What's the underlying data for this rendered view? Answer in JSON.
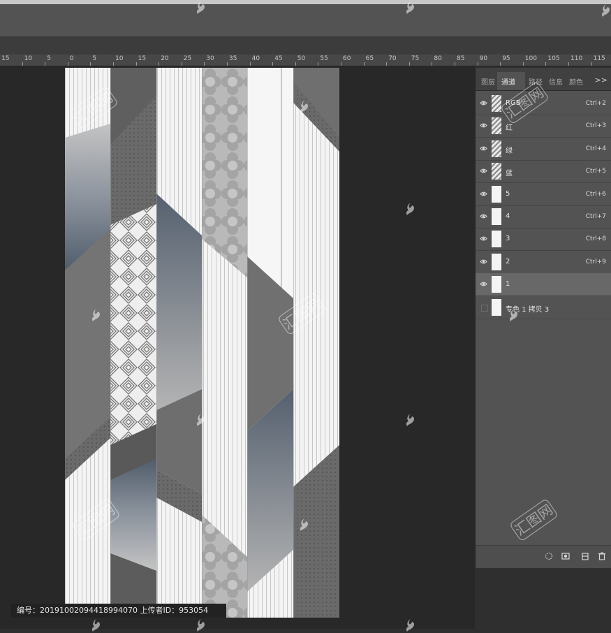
{
  "ruler": {
    "labels": [
      "15",
      "10",
      "5",
      "0",
      "5",
      "10",
      "15",
      "20",
      "25",
      "30",
      "35",
      "40",
      "45",
      "50",
      "55",
      "60",
      "65",
      "70",
      "75",
      "80",
      "85",
      "90",
      "95",
      "100",
      "105",
      "110",
      "115"
    ]
  },
  "panel": {
    "tabs": [
      "图层",
      "通道",
      "路径",
      "信息",
      "颜色"
    ],
    "menu": ">>",
    "channels": [
      {
        "name": "RGB",
        "shortcut": "Ctrl+2",
        "visible": true,
        "thumb": "pattern",
        "selected": false
      },
      {
        "name": "红",
        "shortcut": "Ctrl+3",
        "visible": true,
        "thumb": "pattern",
        "selected": false
      },
      {
        "name": "绿",
        "shortcut": "Ctrl+4",
        "visible": true,
        "thumb": "pattern",
        "selected": false
      },
      {
        "name": "蓝",
        "shortcut": "Ctrl+5",
        "visible": true,
        "thumb": "pattern",
        "selected": false
      },
      {
        "name": "5",
        "shortcut": "Ctrl+6",
        "visible": true,
        "thumb": "white",
        "selected": false
      },
      {
        "name": "4",
        "shortcut": "Ctrl+7",
        "visible": true,
        "thumb": "white",
        "selected": false
      },
      {
        "name": "3",
        "shortcut": "Ctrl+8",
        "visible": true,
        "thumb": "white",
        "selected": false
      },
      {
        "name": "2",
        "shortcut": "Ctrl+9",
        "visible": true,
        "thumb": "white",
        "selected": false
      },
      {
        "name": "1",
        "shortcut": "",
        "visible": true,
        "thumb": "white",
        "selected": true
      },
      {
        "name": "专色 1 拷贝 3",
        "shortcut": "",
        "visible": false,
        "thumb": "white",
        "selected": false
      }
    ]
  },
  "footer": {
    "text": "编号：20191002094418994070 上传者ID：953054"
  },
  "watermark": {
    "text": "汇图网"
  },
  "colors": {
    "workspace": "#282828",
    "panel": "#535353",
    "slate": "#55606f"
  }
}
